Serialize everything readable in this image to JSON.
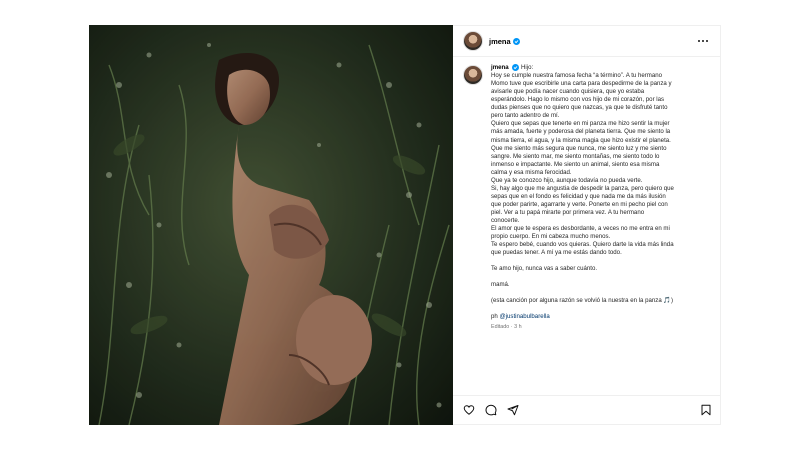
{
  "post": {
    "username": "jmena",
    "caption": {
      "username": "jmena",
      "lines": [
        "Hijo:",
        "Hoy se cumple nuestra famosa fecha “a término”. A tu hermano",
        "Momo tuve que escribirle una carta para despedirme de la panza y",
        "avisarle que podía nacer cuando quisiera, que yo estaba",
        "esperándolo. Hago lo mismo con vos hijo de mi corazón, por las",
        "dudas pienses que no quiero que nazcas, ya que te disfruté tanto",
        "pero tanto adentro de mí.",
        "Quiero que sepas que tenerte en mi panza me hizo sentir la mujer",
        "más amada, fuerte y poderosa del planeta tierra. Que me siento la",
        "misma tierra, el agua, y la misma magia que hizo existir el planeta.",
        "Que me siento más segura que nunca, me siento luz y me siento",
        "sangre. Me siento mar, me siento montañas, me siento todo lo",
        "inmenso e impactante. Me siento un animal, siento esa misma",
        "calma y esa misma ferocidad.",
        "Que ya te conozco hijo, aunque todavía no pueda verte.",
        "Si, hay algo que me angustia de despedir la panza, pero quiero que",
        "sepas que en el fondo es felicidad y que nada me da más ilusión",
        "que poder parirte, agarrarte y verte. Ponerte en mi pecho piel con",
        "piel. Ver a tu papá mirarte por primera vez. A tu hermano",
        "conocerte.",
        "El amor que te espera es desbordante, a veces no me entra en mi",
        "propio cuerpo. En mi cabeza mucho menos.",
        "Te espero bebé, cuando vos quieras. Quiero darte la vida más linda",
        "que puedas tener. A mí ya me estás dando todo."
      ],
      "closing": "Te amo hijo, nunca vas a saber cuánto.",
      "signature": "mamá.",
      "note": "(esta canción por alguna razón se volvió la nuestra en la panza 🎵)",
      "credit_prefix": "ph",
      "credit_handle": "@justinabulbarella",
      "edited": "Editado · 3 h"
    },
    "icons": [
      "verified-badge",
      "more-options",
      "heart",
      "comment",
      "share",
      "bookmark"
    ]
  }
}
